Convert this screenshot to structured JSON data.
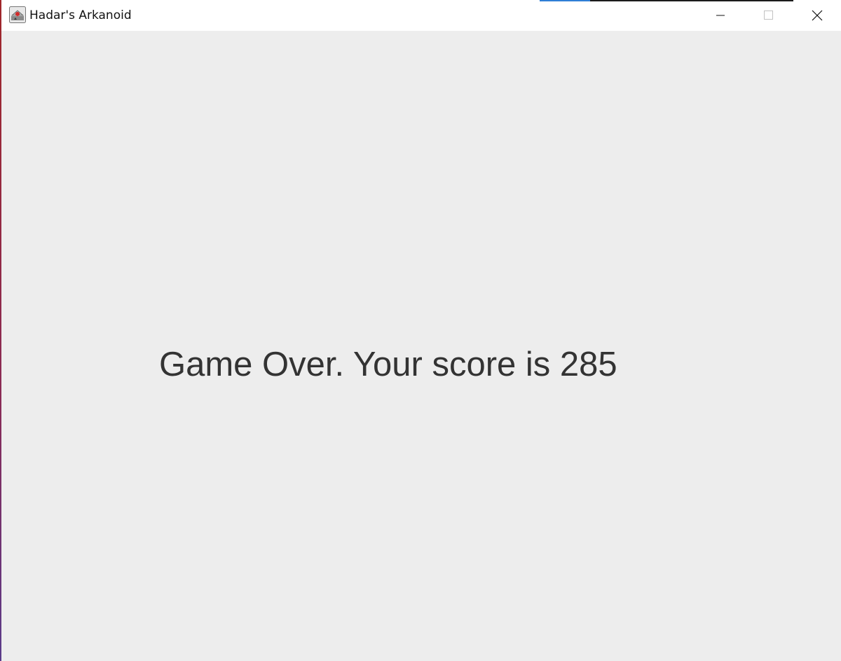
{
  "window": {
    "title": "Hadar's Arkanoid",
    "app_icon": "java-app-icon",
    "controls": {
      "minimize_icon": "minimize-icon",
      "maximize_icon": "maximize-icon",
      "close_icon": "close-icon"
    }
  },
  "game": {
    "message": "Game Over. Your score is 285",
    "background_color": "#ededed",
    "text_color": "#333333"
  }
}
